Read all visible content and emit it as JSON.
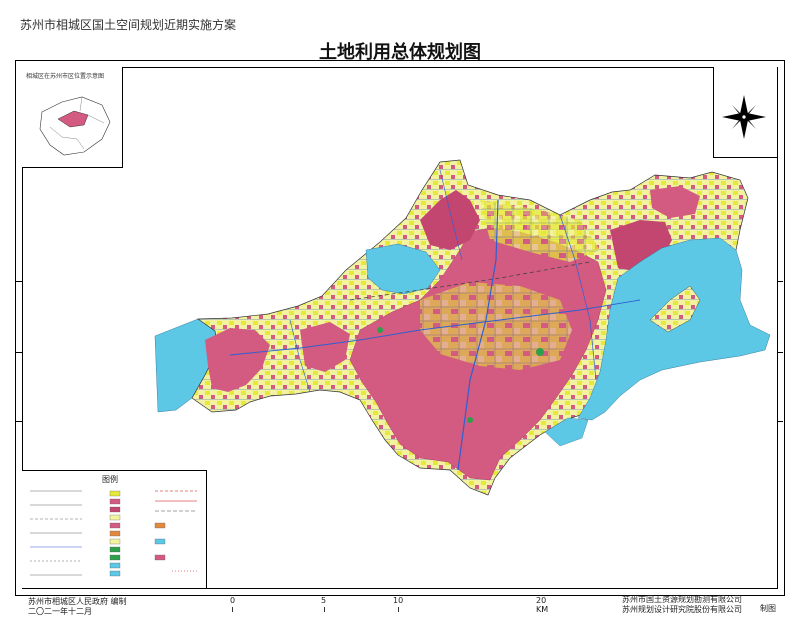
{
  "header": {
    "project_title": "苏州市相城区国土空间规划近期实施方案",
    "map_title": "土地利用总体规划图"
  },
  "inset": {
    "title": "相城区在苏州市区位置示意图"
  },
  "legend": {
    "title": "图例"
  },
  "scale": {
    "labels": [
      "0",
      "5",
      "10",
      "20 KM"
    ]
  },
  "footer": {
    "left_line1": "苏州市相城区人民政府 编制",
    "left_line2": "二〇二一年十二月",
    "right_line1": "苏州市国土资源规划勘测有限公司",
    "right_line2": "苏州规划设计研究院股份有限公司",
    "right_tag": "制图"
  },
  "colors": {
    "urban": "#d35a80",
    "urban_dark": "#c24670",
    "rural_settlement": "#e6e83a",
    "farmland": "#f2f2a0",
    "water": "#5cc8e6",
    "roads": "#2f5fd0",
    "green": "#2ea04a",
    "industrial": "#e08a40"
  },
  "icons": {
    "compass": "north-arrow-icon",
    "legend_swatches": "legend-swatch-icons"
  }
}
